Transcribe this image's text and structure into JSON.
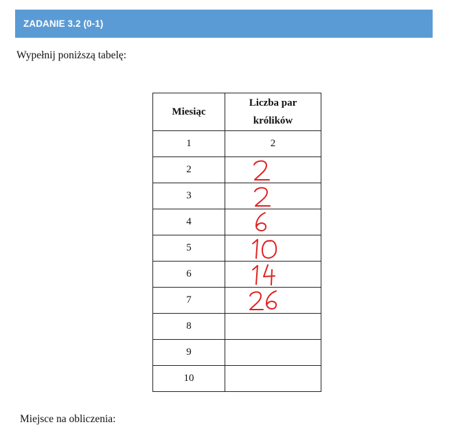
{
  "header": {
    "title": "ZADANIE 3.2 (0-1)",
    "background_color": "#5b9bd5"
  },
  "instruction": "Wypełnij poniższą tabelę:",
  "table": {
    "columns": [
      "Miesiąc",
      "Liczba par królików"
    ],
    "rows": [
      {
        "month": "1",
        "pairs": "2",
        "source": "printed"
      },
      {
        "month": "2",
        "pairs": "2",
        "source": "handwritten"
      },
      {
        "month": "3",
        "pairs": "2",
        "source": "handwritten"
      },
      {
        "month": "4",
        "pairs": "6",
        "source": "handwritten"
      },
      {
        "month": "5",
        "pairs": "10",
        "source": "handwritten"
      },
      {
        "month": "6",
        "pairs": "14",
        "source": "handwritten"
      },
      {
        "month": "7",
        "pairs": "26",
        "source": "handwritten"
      },
      {
        "month": "8",
        "pairs": "",
        "source": "empty"
      },
      {
        "month": "9",
        "pairs": "",
        "source": "empty"
      },
      {
        "month": "10",
        "pairs": "",
        "source": "empty"
      }
    ],
    "handwriting_color": "#e02020"
  },
  "footer": {
    "label": "Miejsce na obliczenia:"
  }
}
